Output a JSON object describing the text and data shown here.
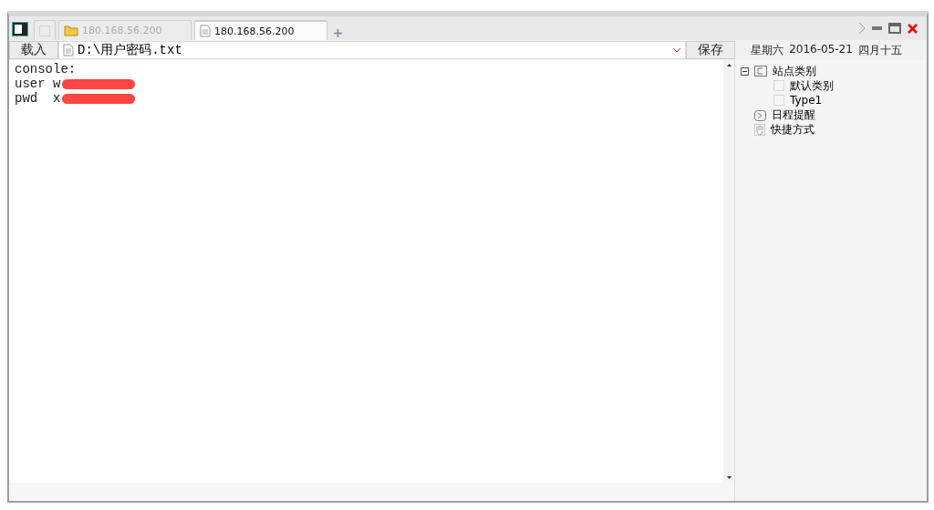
{
  "tabs": [
    {
      "kind": "folder",
      "label": "180.168.56.200",
      "selected": false
    },
    {
      "kind": "file",
      "label": "180.168.56.200",
      "selected": true
    }
  ],
  "toolbar": {
    "load_button": "载入",
    "path_field": {
      "value": "D:\\用户密码.txt"
    },
    "save_button": "保存"
  },
  "calendar": {
    "weekday": "星期六",
    "date": "2016-05-21",
    "lunar_date": "四月十五"
  },
  "editor": {
    "lines": [
      {
        "text": "console:",
        "redacted": false
      },
      {
        "text": "user w",
        "redacted": true
      },
      {
        "text": "pwd  x",
        "redacted": true
      }
    ]
  },
  "tree": [
    {
      "kind": "category",
      "label": "站点类别",
      "expanded": true,
      "children": [
        {
          "kind": "item",
          "label": "默认类别"
        },
        {
          "kind": "item",
          "label": "Type1"
        }
      ]
    },
    {
      "kind": "schedule",
      "label": "日程提醒"
    },
    {
      "kind": "shortcut",
      "label": "快捷方式"
    }
  ]
}
